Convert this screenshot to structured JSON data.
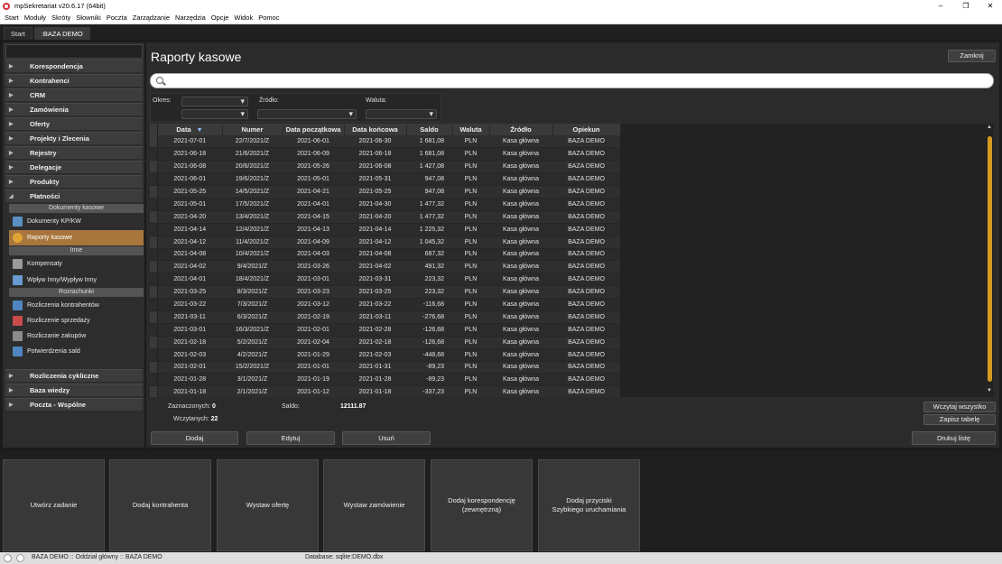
{
  "window": {
    "title": "mpSekretariat v20.6.17 (64bit)",
    "minimize": "–",
    "maximize": "❐",
    "close": "✕"
  },
  "menu": [
    "Start",
    "Moduły",
    "Skróty",
    "Słowniki",
    "Poczta",
    "Zarządzanie",
    "Narzędzia",
    "Opcje",
    "Widok",
    "Pomoc"
  ],
  "tabs": [
    {
      "label": "Start"
    },
    {
      "label": ":BAZA DEMO"
    }
  ],
  "sidebar": {
    "groups_top": [
      "Korespondencja",
      "Kontrahenci",
      "CRM",
      "Zamówienia",
      "Oferty",
      "Projekty i Zlecenia",
      "Rejestry",
      "Delegacje",
      "Produkty",
      "Płatności"
    ],
    "sections": [
      "Dokumenty kasowe",
      "Inne",
      "Rozrachunki"
    ],
    "items": [
      "Dokumenty KP/KW",
      "Raporty kasowe",
      "Kompensaty",
      "Wpływ Inny/Wypływ Inny",
      "Rozliczenia kontrahentów",
      "Rozliczenie sprzedaży",
      "Rozliczanie zakupów",
      "Potwierdzenia sald"
    ],
    "groups_bottom": [
      "Rozliczenia cykliczne",
      "Baza wiedzy",
      "Poczta - Wspólne"
    ]
  },
  "main": {
    "title": "Raporty kasowe",
    "close_btn": "Zamknij",
    "filters": {
      "okres": "Okres:",
      "zrodlo": "Źródło:",
      "waluta": "Waluta:"
    },
    "columns": [
      "Data",
      "Numer",
      "Data początkowa",
      "Data końcowa",
      "Saldo",
      "Waluta",
      "Źródło",
      "Opiekun"
    ],
    "rows": [
      [
        "2021-07-01",
        "22/7/2021/Z",
        "2021-06-01",
        "2021-06-30",
        "1 681,08",
        "PLN",
        "Kasa główna",
        "BAZA DEMO"
      ],
      [
        "2021-06-18",
        "21/6/2021/Z",
        "2021-06-09",
        "2021-06-18",
        "1 681,08",
        "PLN",
        "Kasa główna",
        "BAZA DEMO"
      ],
      [
        "2021-06-08",
        "20/6/2021/Z",
        "2021-05-26",
        "2021-06-08",
        "1 427,08",
        "PLN",
        "Kasa główna",
        "BAZA DEMO"
      ],
      [
        "2021-06-01",
        "19/6/2021/Z",
        "2021-05-01",
        "2021-05-31",
        "947,08",
        "PLN",
        "Kasa główna",
        "BAZA DEMO"
      ],
      [
        "2021-05-25",
        "14/5/2021/Z",
        "2021-04-21",
        "2021-05-25",
        "947,08",
        "PLN",
        "Kasa główna",
        "BAZA DEMO"
      ],
      [
        "2021-05-01",
        "17/5/2021/Z",
        "2021-04-01",
        "2021-04-30",
        "1 477,32",
        "PLN",
        "Kasa główna",
        "BAZA DEMO"
      ],
      [
        "2021-04-20",
        "13/4/2021/Z",
        "2021-04-15",
        "2021-04-20",
        "1 477,32",
        "PLN",
        "Kasa główna",
        "BAZA DEMO"
      ],
      [
        "2021-04-14",
        "12/4/2021/Z",
        "2021-04-13",
        "2021-04-14",
        "1 225,32",
        "PLN",
        "Kasa główna",
        "BAZA DEMO"
      ],
      [
        "2021-04-12",
        "11/4/2021/Z",
        "2021-04-09",
        "2021-04-12",
        "1 045,32",
        "PLN",
        "Kasa główna",
        "BAZA DEMO"
      ],
      [
        "2021-04-08",
        "10/4/2021/Z",
        "2021-04-03",
        "2021-04-08",
        "687,32",
        "PLN",
        "Kasa główna",
        "BAZA DEMO"
      ],
      [
        "2021-04-02",
        "9/4/2021/Z",
        "2021-03-26",
        "2021-04-02",
        "491,32",
        "PLN",
        "Kasa główna",
        "BAZA DEMO"
      ],
      [
        "2021-04-01",
        "18/4/2021/Z",
        "2021-03-01",
        "2021-03-31",
        "223,32",
        "PLN",
        "Kasa główna",
        "BAZA DEMO"
      ],
      [
        "2021-03-25",
        "8/3/2021/Z",
        "2021-03-23",
        "2021-03-25",
        "223,32",
        "PLN",
        "Kasa główna",
        "BAZA DEMO"
      ],
      [
        "2021-03-22",
        "7/3/2021/Z",
        "2021-03-12",
        "2021-03-22",
        "-116,68",
        "PLN",
        "Kasa główna",
        "BAZA DEMO"
      ],
      [
        "2021-03-11",
        "6/3/2021/Z",
        "2021-02-19",
        "2021-03-11",
        "-276,68",
        "PLN",
        "Kasa główna",
        "BAZA DEMO"
      ],
      [
        "2021-03-01",
        "16/3/2021/Z",
        "2021-02-01",
        "2021-02-28",
        "-126,68",
        "PLN",
        "Kasa główna",
        "BAZA DEMO"
      ],
      [
        "2021-02-18",
        "5/2/2021/Z",
        "2021-02-04",
        "2021-02-18",
        "-126,68",
        "PLN",
        "Kasa główna",
        "BAZA DEMO"
      ],
      [
        "2021-02-03",
        "4/2/2021/Z",
        "2021-01-29",
        "2021-02-03",
        "-448,68",
        "PLN",
        "Kasa główna",
        "BAZA DEMO"
      ],
      [
        "2021-02-01",
        "15/2/2021/Z",
        "2021-01-01",
        "2021-01-31",
        "-89,23",
        "PLN",
        "Kasa główna",
        "BAZA DEMO"
      ],
      [
        "2021-01-28",
        "3/1/2021/Z",
        "2021-01-19",
        "2021-01-28",
        "-89,23",
        "PLN",
        "Kasa główna",
        "BAZA DEMO"
      ],
      [
        "2021-01-18",
        "2/1/2021/Z",
        "2021-01-12",
        "2021-01-18",
        "-337,23",
        "PLN",
        "Kasa główna",
        "BAZA DEMO"
      ]
    ],
    "summary": {
      "zaznaczonych_label": "Zaznaczonych:",
      "zaznaczonych": "0",
      "wczytanych_label": "Wczytanych:",
      "wczytanych": "22",
      "saldo_label": "Saldo:",
      "saldo": "12111.87"
    },
    "buttons": {
      "wczytaj": "Wczytaj wszystko",
      "zapisz": "Zapisz tabelę",
      "dodaj": "Dodaj",
      "edytuj": "Edytuj",
      "usun": "Usuń",
      "drukuj": "Drukuj listę"
    }
  },
  "tiles": [
    "Utwórz zadanie",
    "Dodaj kontrahenta",
    "Wystaw ofertę",
    "Wystaw zamówienie",
    "Dodaj korespondencję\n(zewnętrzną)",
    "Dodaj przyciski\nSzybkiego uruchamiania"
  ],
  "status": {
    "left": "BAZA DEMO :: Oddział główny :: BAZA DEMO",
    "db": "Database: sqlite:DEMO.dbx"
  },
  "colors": {
    "accent": "#a8763c",
    "scroll": "#d59b21"
  }
}
